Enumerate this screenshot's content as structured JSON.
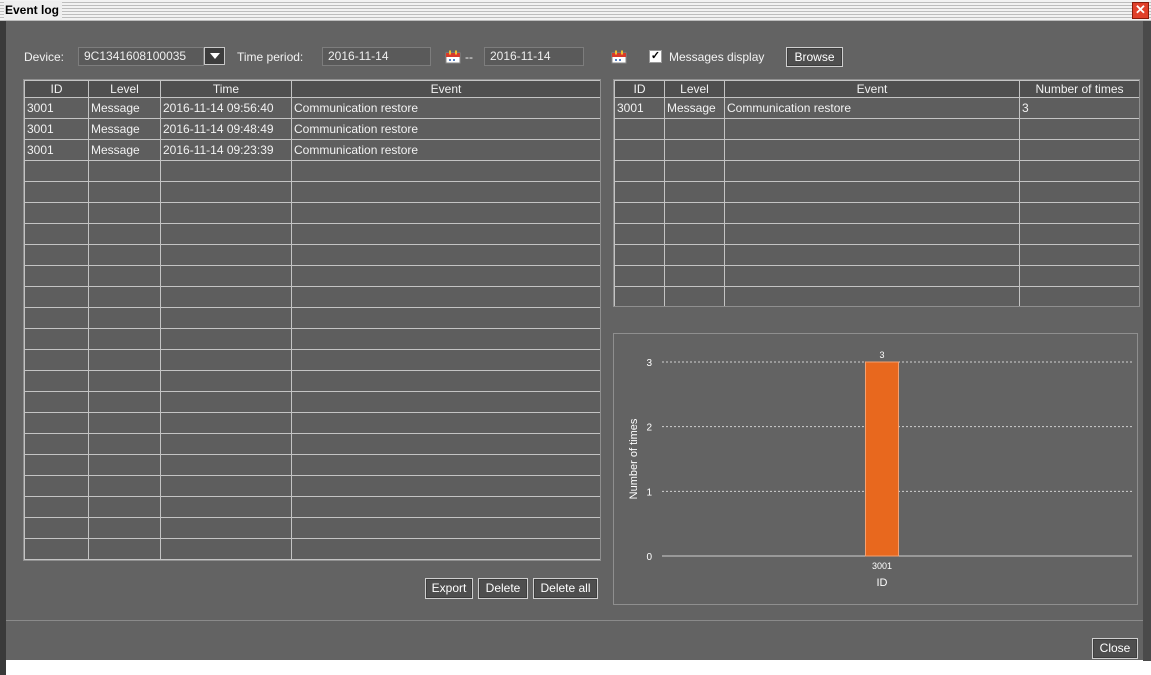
{
  "window": {
    "title": "Event log"
  },
  "toolbar": {
    "device_label": "Device:",
    "device_value": "9C1341608100035",
    "time_period_label": "Time period:",
    "date_from": "2016-11-14",
    "range_sep": "--",
    "date_to": "2016-11-14",
    "messages_display_label": "Messages display",
    "messages_display_checked": true,
    "browse_label": "Browse"
  },
  "left_table": {
    "columns": [
      "ID",
      "Level",
      "Time",
      "Event"
    ],
    "rows": [
      [
        "3001",
        "Message",
        "2016-11-14 09:56:40",
        "Communication restore"
      ],
      [
        "3001",
        "Message",
        "2016-11-14 09:48:49",
        "Communication restore"
      ],
      [
        "3001",
        "Message",
        "2016-11-14 09:23:39",
        "Communication restore"
      ]
    ]
  },
  "right_table": {
    "columns": [
      "ID",
      "Level",
      "Event",
      "Number of times"
    ],
    "rows": [
      [
        "3001",
        "Message",
        "Communication restore",
        "3"
      ]
    ]
  },
  "actions": {
    "export_label": "Export",
    "delete_label": "Delete",
    "delete_all_label": "Delete all"
  },
  "footer": {
    "close_label": "Close"
  },
  "colors": {
    "bar": "#e8681e",
    "background": "#636363",
    "grid": "#c4c4c4"
  },
  "chart_data": {
    "type": "bar",
    "categories": [
      "3001"
    ],
    "values": [
      3
    ],
    "data_labels": [
      "3"
    ],
    "xlabel": "ID",
    "ylabel": "Number of times",
    "ylim": [
      0,
      3
    ],
    "yticks": [
      0,
      1,
      2,
      3
    ],
    "grid": true
  }
}
